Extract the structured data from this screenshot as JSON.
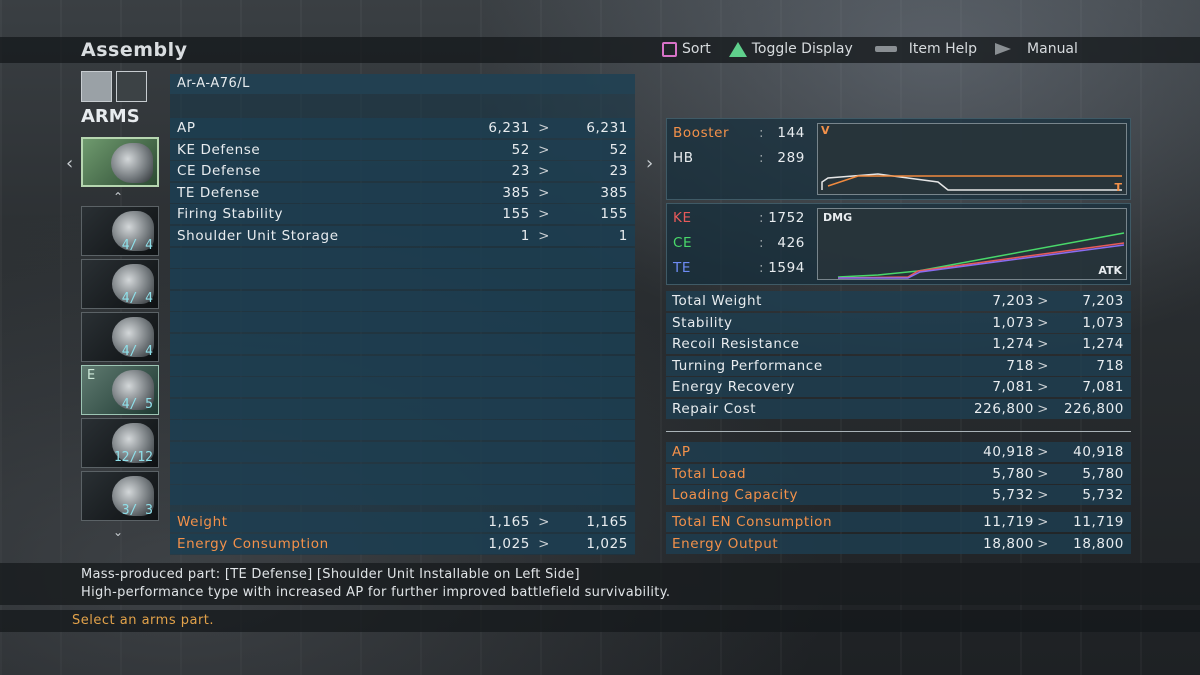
{
  "header": {
    "title": "Assembly",
    "hints": [
      {
        "icon": "square-button-icon",
        "label": "Sort"
      },
      {
        "icon": "triangle-button-icon",
        "label": "Toggle Display"
      },
      {
        "icon": "select-button-icon",
        "label": "Item Help"
      },
      {
        "icon": "start-button-icon",
        "label": "Manual"
      }
    ]
  },
  "category": {
    "label": "ARMS"
  },
  "parts": [
    {
      "count": "",
      "equipped": false,
      "selected": true
    },
    {
      "count": "4/ 4",
      "equipped": false,
      "selected": false
    },
    {
      "count": "4/ 4",
      "equipped": false,
      "selected": false
    },
    {
      "count": "4/ 4",
      "equipped": false,
      "selected": false
    },
    {
      "count": "4/ 5",
      "equipped": true,
      "equipped_mark": "E",
      "selected": false
    },
    {
      "count": "12/12",
      "equipped": false,
      "selected": false
    },
    {
      "count": "3/ 3",
      "equipped": false,
      "selected": false
    }
  ],
  "part_stats": {
    "name": "Ar-A-A76/L",
    "rows": [
      {
        "label": "AP",
        "current": "6,231",
        "new": "6,231"
      },
      {
        "label": "KE Defense",
        "current": "52",
        "new": "52"
      },
      {
        "label": "CE Defense",
        "current": "23",
        "new": "23"
      },
      {
        "label": "TE Defense",
        "current": "385",
        "new": "385"
      },
      {
        "label": "Firing Stability",
        "current": "155",
        "new": "155"
      },
      {
        "label": "Shoulder Unit Storage",
        "current": "1",
        "new": "1"
      }
    ],
    "footer_rows": [
      {
        "label": "Weight",
        "current": "1,165",
        "new": "1,165"
      },
      {
        "label": "Energy Consumption",
        "current": "1,025",
        "new": "1,025"
      }
    ]
  },
  "booster": {
    "booster_label": "Booster",
    "booster_value": "144",
    "hb_label": "HB",
    "hb_value": "289",
    "graph_v": "V",
    "graph_t": "T"
  },
  "damage": {
    "ke_label": "KE",
    "ke_value": "1752",
    "ce_label": "CE",
    "ce_value": "426",
    "te_label": "TE",
    "te_value": "1594",
    "graph_title": "DMG",
    "graph_axis": "ATK",
    "colors": {
      "ke": "#e85a5a",
      "ce": "#49d86a",
      "te": "#5a7cf0"
    }
  },
  "ac_stats": {
    "rows": [
      {
        "label": "Total Weight",
        "current": "7,203",
        "new": "7,203"
      },
      {
        "label": "Stability",
        "current": "1,073",
        "new": "1,073"
      },
      {
        "label": "Recoil Resistance",
        "current": "1,274",
        "new": "1,274"
      },
      {
        "label": "Turning Performance",
        "current": "718",
        "new": "718"
      },
      {
        "label": "Energy Recovery",
        "current": "7,081",
        "new": "7,081"
      },
      {
        "label": "Repair Cost",
        "current": "226,800",
        "new": "226,800"
      }
    ],
    "load_rows": [
      {
        "label": "AP",
        "current": "40,918",
        "new": "40,918"
      },
      {
        "label": "Total Load",
        "current": "5,780",
        "new": "5,780"
      },
      {
        "label": "Loading Capacity",
        "current": "5,732",
        "new": "5,732"
      }
    ],
    "energy_rows": [
      {
        "label": "Total EN Consumption",
        "current": "11,719",
        "new": "11,719"
      },
      {
        "label": "Energy Output",
        "current": "18,800",
        "new": "18,800"
      }
    ]
  },
  "description": {
    "line1": "Mass-produced part: [TE Defense] [Shoulder Unit Installable on Left Side]",
    "line2": "High-performance type with increased AP for further improved battlefield survivability."
  },
  "footer": {
    "hint": "Select an arms part."
  }
}
